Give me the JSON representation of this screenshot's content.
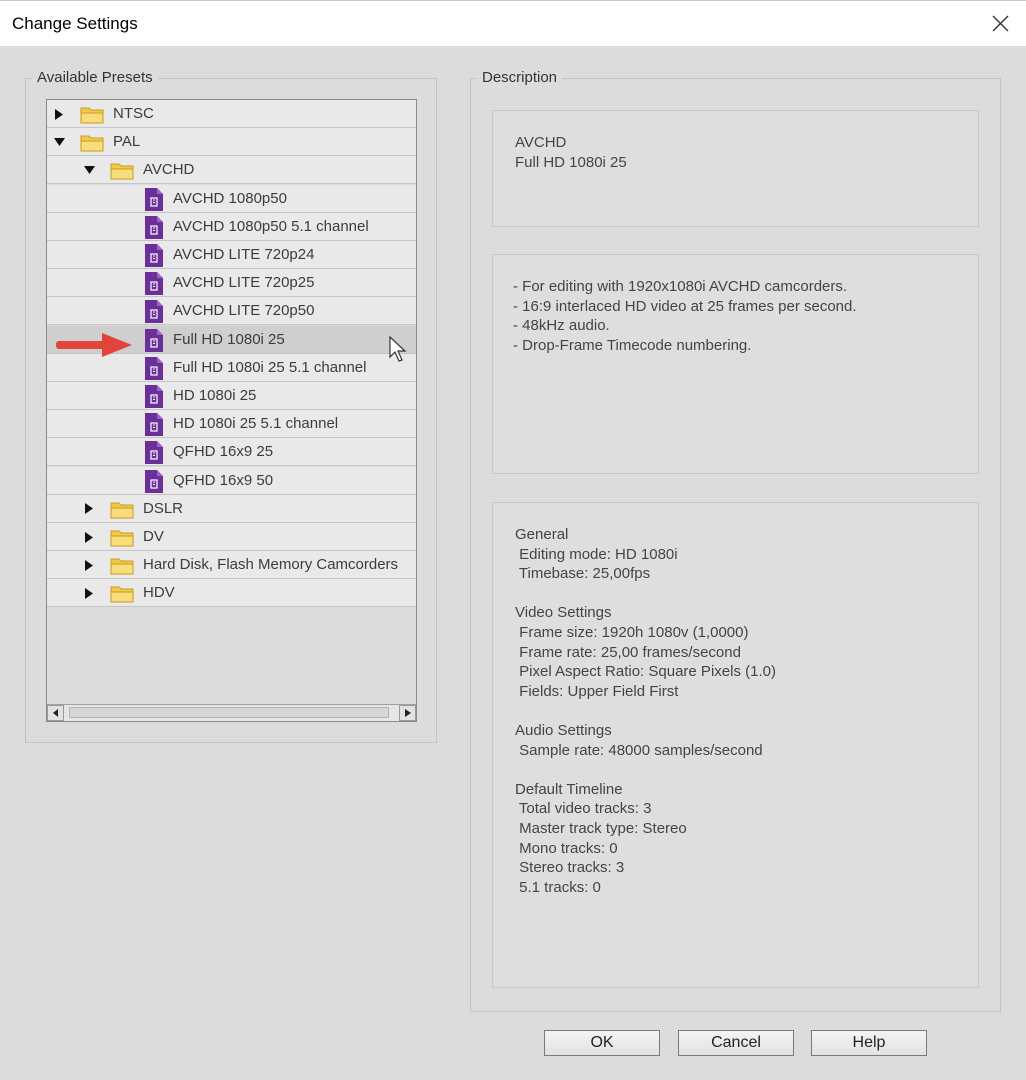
{
  "window": {
    "title": "Change Settings"
  },
  "presets": {
    "legend": "Available Presets",
    "items": [
      {
        "label": "NTSC"
      },
      {
        "label": "PAL"
      },
      {
        "label": "AVCHD"
      },
      {
        "label": "AVCHD 1080p50"
      },
      {
        "label": "AVCHD 1080p50 5.1 channel"
      },
      {
        "label": "AVCHD LITE 720p24"
      },
      {
        "label": "AVCHD LITE 720p25"
      },
      {
        "label": "AVCHD LITE 720p50"
      },
      {
        "label": "Full HD 1080i 25"
      },
      {
        "label": "Full HD 1080i 25 5.1 channel"
      },
      {
        "label": "HD 1080i 25"
      },
      {
        "label": "HD 1080i 25 5.1 channel"
      },
      {
        "label": "QFHD 16x9 25"
      },
      {
        "label": "QFHD 16x9 50"
      },
      {
        "label": "DSLR"
      },
      {
        "label": "DV"
      },
      {
        "label": "Hard Disk, Flash Memory Camcorders"
      },
      {
        "label": "HDV"
      }
    ]
  },
  "description": {
    "legend": "Description",
    "name_block": "AVCHD\nFull HD 1080i 25",
    "notes": "- For editing with 1920x1080i AVCHD camcorders.\n- 16:9 interlaced HD video at 25 frames per second.\n- 48kHz audio.\n- Drop-Frame Timecode numbering.",
    "details": "General\n Editing mode: HD 1080i\n Timebase: 25,00fps\n\nVideo Settings\n Frame size: 1920h 1080v (1,0000)\n Frame rate: 25,00 frames/second\n Pixel Aspect Ratio: Square Pixels (1.0)\n Fields: Upper Field First\n\nAudio Settings\n Sample rate: 48000 samples/second\n\nDefault Timeline\n Total video tracks: 3\n Master track type: Stereo\n Mono tracks: 0\n Stereo tracks: 3\n 5.1 tracks: 0"
  },
  "buttons": {
    "ok": "OK",
    "cancel": "Cancel",
    "help": "Help"
  },
  "colors": {
    "folder": "#f2c84b",
    "preset_icon": "#6b2f9a",
    "pointer_arrow": "#e2433a",
    "selected_row": "#cfcfcf"
  }
}
